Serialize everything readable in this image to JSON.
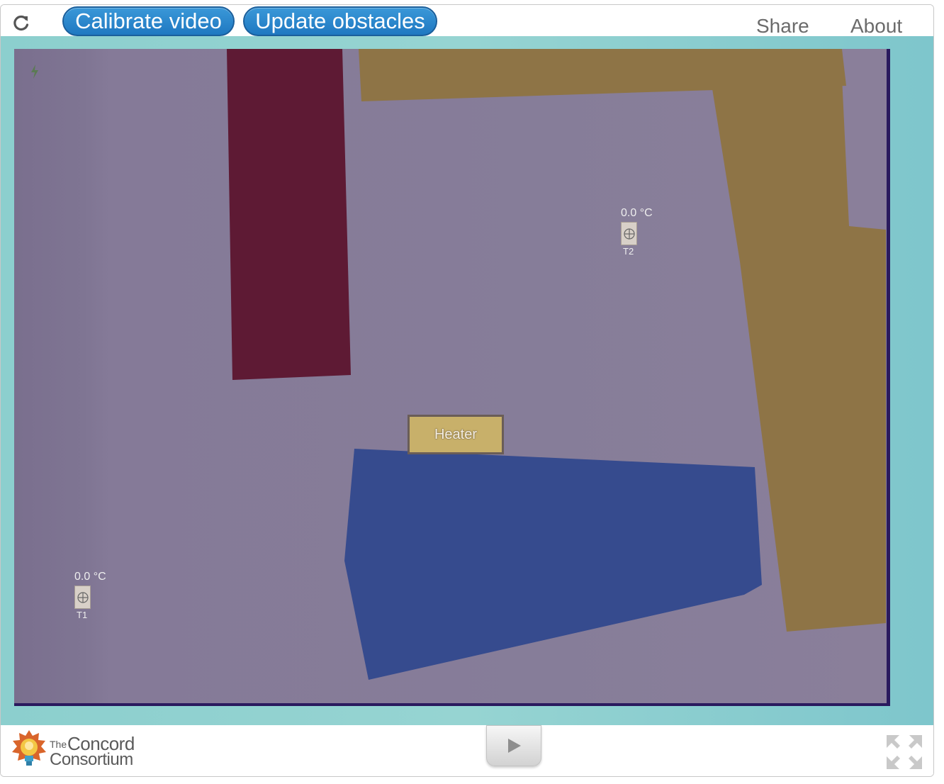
{
  "toolbar": {
    "reload_icon": "reload-icon",
    "calibrate_label": "Calibrate video",
    "update_label": "Update obstacles",
    "share_label": "Share",
    "about_label": "About"
  },
  "colors": {
    "button_blue": "#2a8ad0",
    "stage_teal": "#8ccfce",
    "video_bg": "#867d99",
    "red_obstacle": "#5e1a34",
    "yellow_obstacle": "#8e7446",
    "blue_obstacle": "#364b8e"
  },
  "sensors": [
    {
      "reading": "0.0 °C",
      "label": "T2"
    },
    {
      "reading": "0.0 °C",
      "label": "T1"
    }
  ],
  "heater": {
    "label": "Heater"
  },
  "footer": {
    "logo_the": "The",
    "logo_line1": "Concord",
    "logo_line2": "Consortium",
    "play_icon": "play-icon",
    "fullscreen_icon": "fullscreen-icon"
  }
}
